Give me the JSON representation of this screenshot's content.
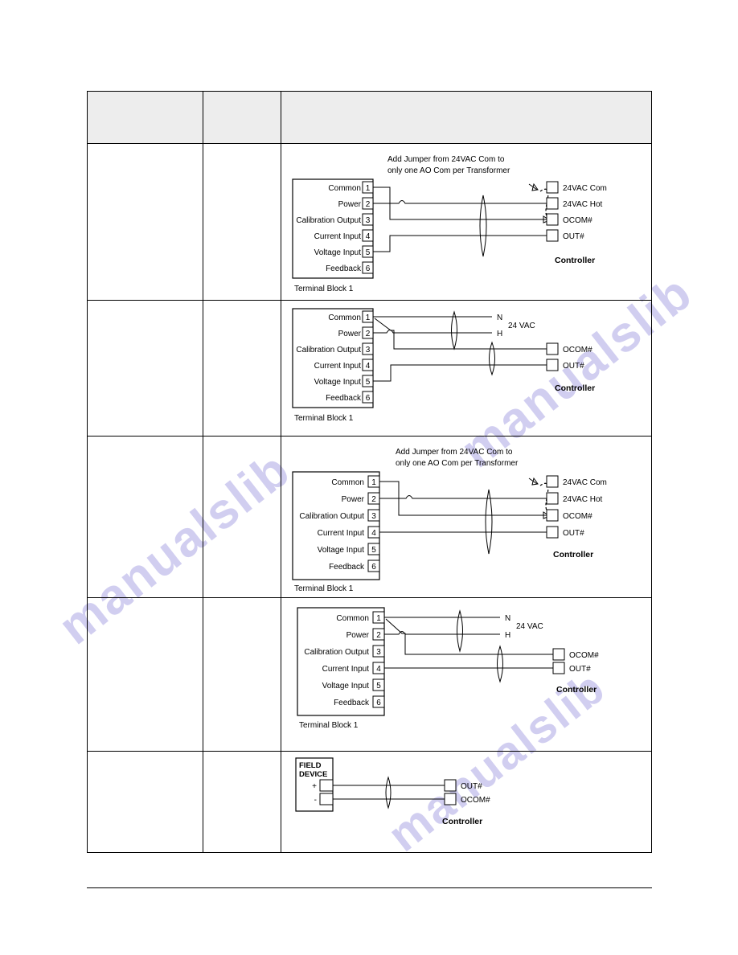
{
  "page": {
    "watermark_text": "manualslib",
    "watermark_color": "#c9c6ee",
    "background": "#ffffff"
  },
  "table": {
    "header": {
      "col_a": "",
      "col_b": "",
      "col_c": ""
    },
    "columns": [
      "",
      "",
      ""
    ]
  },
  "terminal_block": {
    "caption": "Terminal Block 1",
    "terminals": [
      {
        "number": "1",
        "label": "Common"
      },
      {
        "number": "2",
        "label": "Power"
      },
      {
        "number": "3",
        "label": "Calibration Output"
      },
      {
        "number": "4",
        "label": "Current Input"
      },
      {
        "number": "5",
        "label": "Voltage Input"
      },
      {
        "number": "6",
        "label": "Feedback"
      }
    ]
  },
  "controller": {
    "caption": "Controller",
    "terminals_full": [
      "24VAC Com",
      "24VAC Hot",
      "OCOM#",
      "OUT#"
    ],
    "terminals_short": [
      "OCOM#",
      "OUT#"
    ],
    "terminals_field": [
      "OUT#",
      "OCOM#"
    ]
  },
  "notes": {
    "jumper_line1": "Add Jumper from 24VAC Com to",
    "jumper_line2": "only one AO Com per Transformer"
  },
  "supply": {
    "neutral": "N",
    "hot": "H",
    "label": "24 VAC"
  },
  "field_device": {
    "title_line1": "FIELD",
    "title_line2": "DEVICE",
    "plus": "+",
    "minus": "-"
  },
  "diagrams": [
    {
      "id": "diagram-1",
      "name": "terminal-block-to-controller-24vac-transformer",
      "note": true,
      "controller_terminals": [
        "24VAC Com",
        "24VAC Hot",
        "OCOM#",
        "OUT#"
      ],
      "connections": [
        {
          "from": "1",
          "to": "OCOM#"
        },
        {
          "from": "2",
          "to": "24VAC Hot"
        },
        {
          "from": "5",
          "to": "OUT#"
        }
      ]
    },
    {
      "id": "diagram-2",
      "name": "terminal-block-to-controller-separate-24vac",
      "note": false,
      "controller_terminals": [
        "OCOM#",
        "OUT#"
      ],
      "supply_terminals": [
        "N",
        "H"
      ],
      "connections": [
        {
          "from": "1",
          "to": "N"
        },
        {
          "from": "2",
          "to": "H"
        },
        {
          "from": "1",
          "to": "OCOM#"
        },
        {
          "from": "5",
          "to": "OUT#"
        }
      ]
    },
    {
      "id": "diagram-3",
      "name": "terminal-block-current-input-transformer",
      "note": true,
      "controller_terminals": [
        "24VAC Com",
        "24VAC Hot",
        "OCOM#",
        "OUT#"
      ],
      "connections": [
        {
          "from": "1",
          "to": "OCOM#"
        },
        {
          "from": "2",
          "to": "24VAC Hot"
        },
        {
          "from": "4",
          "to": "OUT#"
        }
      ]
    },
    {
      "id": "diagram-4",
      "name": "terminal-block-current-input-separate-24vac",
      "note": false,
      "controller_terminals": [
        "OCOM#",
        "OUT#"
      ],
      "supply_terminals": [
        "N",
        "H"
      ],
      "connections": [
        {
          "from": "1",
          "to": "N"
        },
        {
          "from": "2",
          "to": "H"
        },
        {
          "from": "1",
          "to": "OCOM#"
        },
        {
          "from": "4",
          "to": "OUT#"
        }
      ]
    },
    {
      "id": "diagram-5",
      "name": "field-device-to-controller",
      "note": false,
      "controller_terminals": [
        "OUT#",
        "OCOM#"
      ],
      "connections": [
        {
          "from": "+",
          "to": "OUT#"
        },
        {
          "from": "-",
          "to": "OCOM#"
        }
      ]
    }
  ]
}
